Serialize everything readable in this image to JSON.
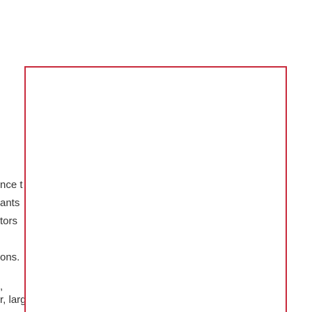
{
  "text_fragments": [
    "nce t",
    "ants",
    "tors",
    "ons.",
    ",",
    "r, large"
  ],
  "colors": {
    "box_border": "#c8293b",
    "text": "#333333",
    "background": "#ffffff"
  }
}
